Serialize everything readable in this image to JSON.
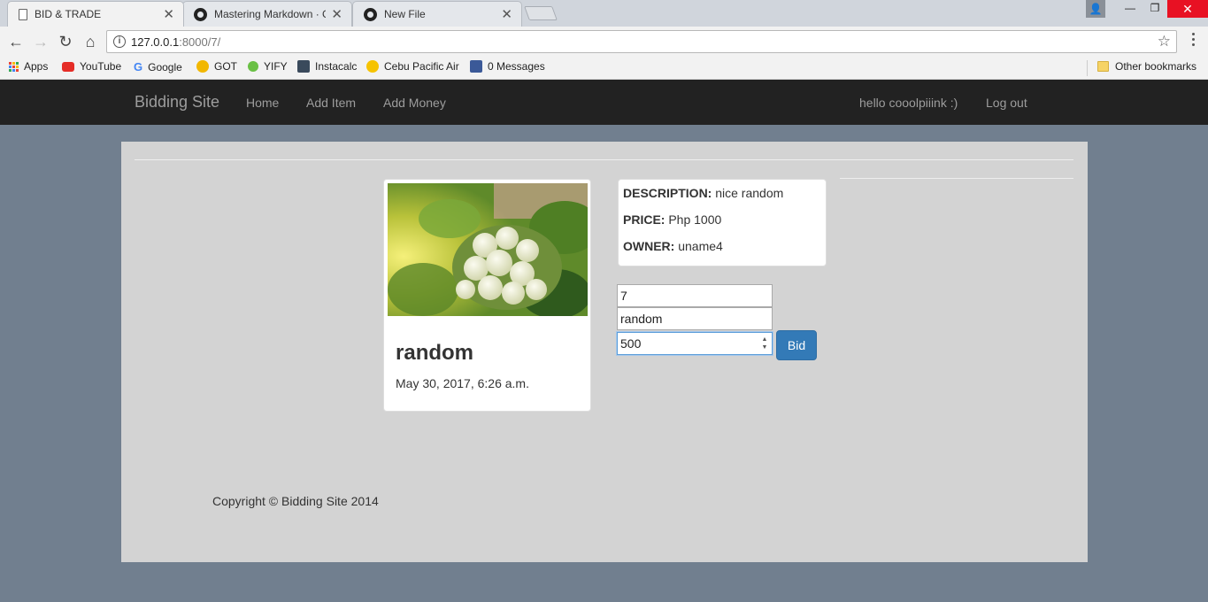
{
  "browser": {
    "tabs": [
      {
        "title": "BID & TRADE",
        "icon": "document-icon",
        "active": true
      },
      {
        "title": "Mastering Markdown · G",
        "icon": "github-icon",
        "active": false
      },
      {
        "title": "New File",
        "icon": "github-icon",
        "active": false
      }
    ],
    "url_host": "127.0.0.1",
    "url_path": ":8000/7/",
    "bookmarks": [
      {
        "label": "Apps",
        "icon": "apps-grid-icon"
      },
      {
        "label": "YouTube",
        "icon": "youtube-icon",
        "color": "#e52d27"
      },
      {
        "label": "Google",
        "icon": "google-icon",
        "color": "#4285f4"
      },
      {
        "label": "GOT",
        "icon": "got-icon",
        "color": "#f2b700"
      },
      {
        "label": "YIFY",
        "icon": "yify-icon",
        "color": "#6ac045"
      },
      {
        "label": "Instacalc",
        "icon": "instacalc-icon",
        "color": "#3a4a5c"
      },
      {
        "label": "Cebu Pacific Air",
        "icon": "cebu-pacific-icon",
        "color": "#f6c300"
      },
      {
        "label": "0 Messages",
        "icon": "facebook-icon",
        "color": "#3b5998"
      }
    ],
    "other_bookmarks": "Other bookmarks"
  },
  "navbar": {
    "brand": "Bidding Site",
    "links": [
      "Home",
      "Add Item",
      "Add Money"
    ],
    "greeting": "hello cooolpiiink :)",
    "logout": "Log out"
  },
  "item": {
    "title": "random",
    "date": "May 30, 2017, 6:26 a.m.",
    "description_label": "DESCRIPTION:",
    "description": "nice random",
    "price_label": "PRICE:",
    "price": "Php 1000",
    "owner_label": "OWNER:",
    "owner": "uname4"
  },
  "bid_form": {
    "item_id": "7",
    "item_name": "random",
    "amount": "500",
    "submit": "Bid"
  },
  "footer": {
    "copyright": "Copyright © Bidding Site 2014"
  },
  "colors": {
    "page_bg": "#717f8f",
    "panel_bg": "#d3d3d3",
    "navbar_bg": "#222222",
    "primary_button": "#337ab7"
  }
}
